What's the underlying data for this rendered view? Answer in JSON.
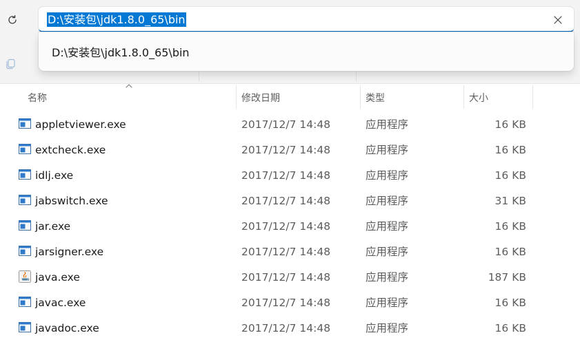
{
  "address_bar": {
    "value": "D:\\安装包\\jdk1.8.0_65\\bin",
    "suggestion": "D:\\安装包\\jdk1.8.0_65\\bin"
  },
  "toolbar": {
    "refresh_icon": "refresh-icon",
    "copy_icon": "copy-icon",
    "clear_icon": "close-icon"
  },
  "columns": {
    "name": "名称",
    "modified": "修改日期",
    "type": "类型",
    "size": "大小",
    "sort_icon": "chevron-up-icon"
  },
  "files": [
    {
      "name": "appletviewer.exe",
      "modified": "2017/12/7 14:48",
      "type": "应用程序",
      "size": "16 KB",
      "icon": "exe-icon"
    },
    {
      "name": "extcheck.exe",
      "modified": "2017/12/7 14:48",
      "type": "应用程序",
      "size": "16 KB",
      "icon": "exe-icon"
    },
    {
      "name": "idlj.exe",
      "modified": "2017/12/7 14:48",
      "type": "应用程序",
      "size": "16 KB",
      "icon": "exe-icon"
    },
    {
      "name": "jabswitch.exe",
      "modified": "2017/12/7 14:48",
      "type": "应用程序",
      "size": "31 KB",
      "icon": "exe-icon"
    },
    {
      "name": "jar.exe",
      "modified": "2017/12/7 14:48",
      "type": "应用程序",
      "size": "16 KB",
      "icon": "exe-icon"
    },
    {
      "name": "jarsigner.exe",
      "modified": "2017/12/7 14:48",
      "type": "应用程序",
      "size": "16 KB",
      "icon": "exe-icon"
    },
    {
      "name": "java.exe",
      "modified": "2017/12/7 14:48",
      "type": "应用程序",
      "size": "187 KB",
      "icon": "java-icon"
    },
    {
      "name": "javac.exe",
      "modified": "2017/12/7 14:48",
      "type": "应用程序",
      "size": "16 KB",
      "icon": "exe-icon"
    },
    {
      "name": "javadoc.exe",
      "modified": "2017/12/7 14:48",
      "type": "应用程序",
      "size": "16 KB",
      "icon": "exe-icon"
    }
  ],
  "colors": {
    "accent": "#0078d4",
    "toolbar_bg": "#f3f3f3",
    "header_text": "#5e5e5e",
    "detail_text": "#5c5c5c"
  }
}
